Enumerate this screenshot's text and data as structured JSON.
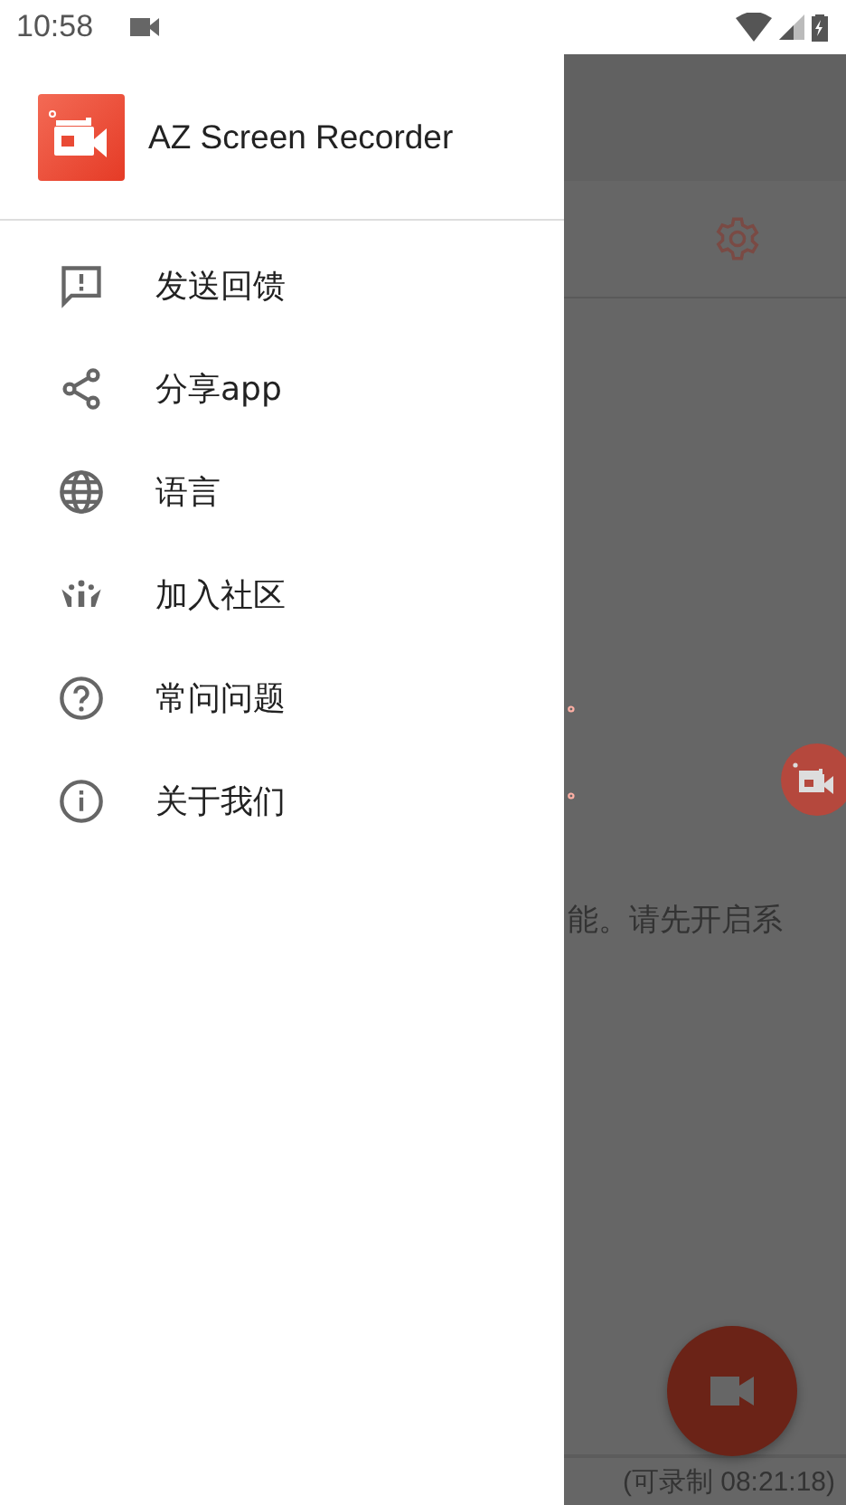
{
  "status_bar": {
    "time": "10:58"
  },
  "drawer": {
    "app_name": "AZ Screen Recorder",
    "items": [
      {
        "kind": "feedback",
        "label": "发送回馈"
      },
      {
        "kind": "share",
        "label": "分享app"
      },
      {
        "kind": "language",
        "label": "语言"
      },
      {
        "kind": "community",
        "label": "加入社区"
      },
      {
        "kind": "faq",
        "label": "常问问题"
      },
      {
        "kind": "about",
        "label": "关于我们"
      }
    ]
  },
  "background": {
    "marks": [
      "。",
      "。"
    ],
    "message": "能。请先开启系",
    "remaining": "(可录制 08:21:18)"
  }
}
